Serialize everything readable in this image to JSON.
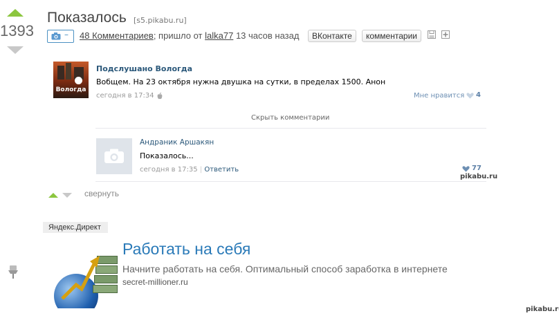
{
  "post": {
    "rating": "1393",
    "title": "Показалось",
    "source": "[s5.pikabu.ru]",
    "photo_label": "–",
    "comments_link": "48 Комментариев",
    "from_text": "; пришло от",
    "author": "lalka77",
    "time_ago": "13 часов назад",
    "vk_button": "ВКонтакте",
    "comments_button": "комментарии"
  },
  "vk_post": {
    "group_name": "Подслушано Вологда",
    "avatar_text": "Вологда",
    "text": "Вобщем. На 23 октября нужна двушка на сутки, в пределах 1500. Анон",
    "time": "сегодня в 17:34",
    "likes_label": "Мне нравится",
    "likes_count": "4",
    "hide_comments": "Скрыть комментарии",
    "comment": {
      "author": "Андраник Аршакян",
      "text": "Показалось...",
      "time": "сегодня в 17:35",
      "separator": "|",
      "reply": "Ответить",
      "likes": "77"
    }
  },
  "collapse_label": "свернуть",
  "watermark": "pikabu.ru",
  "ad": {
    "label": "Яндекс.Директ",
    "title": "Работать на себя",
    "description": "Начните работать на себя. Оптимальный способ заработка в интернете",
    "domain": "secret-millioner.ru"
  },
  "colors": {
    "upvote": "#8cc63f",
    "downvote": "#c8c8c8",
    "vk_link": "#2b587a",
    "ad_title": "#2a7ab8"
  }
}
